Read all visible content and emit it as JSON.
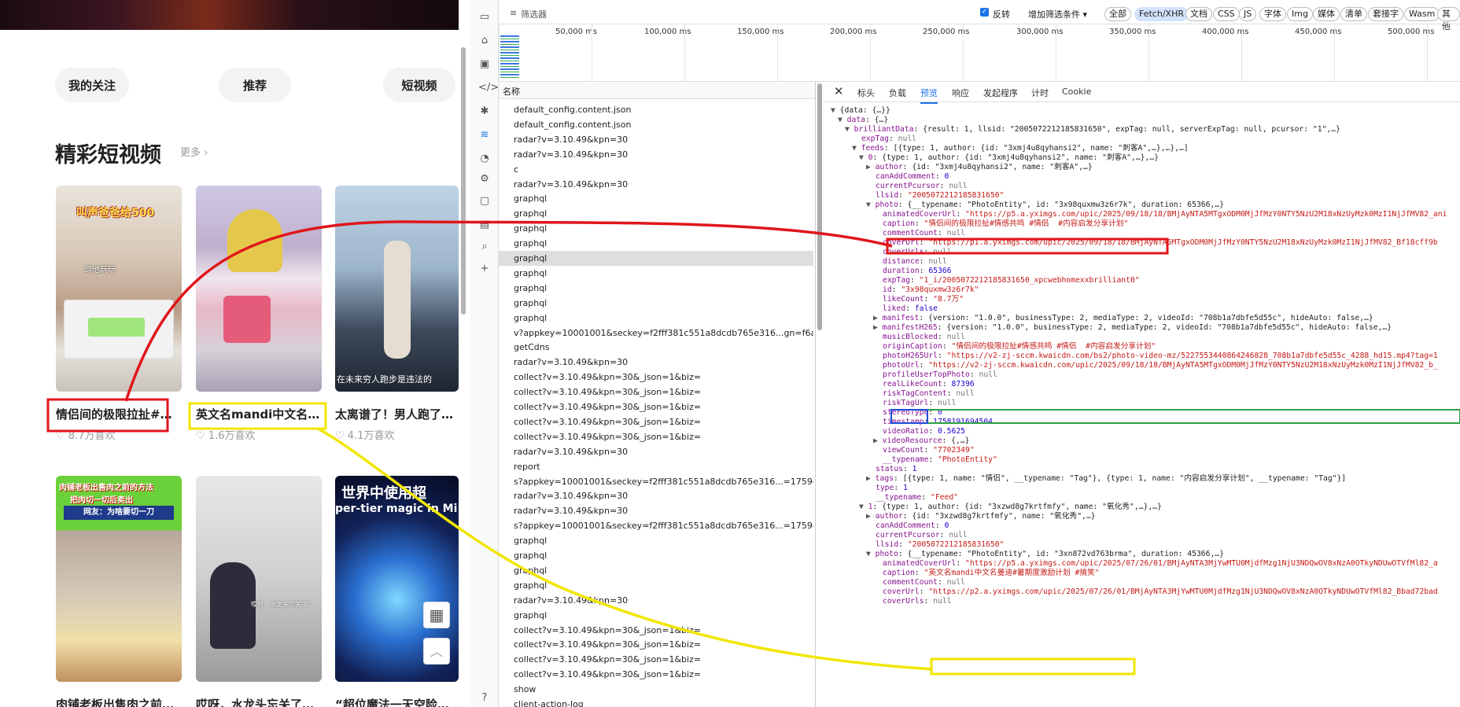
{
  "left": {
    "nav": [
      "我的关注",
      "推荐",
      "短视频"
    ],
    "section_title": "精彩短视频",
    "more_link": "更多",
    "cards_row1": [
      {
        "title": "情侣间的极限拉扯#情…",
        "likes": "8.7万喜欢",
        "overlay_top": "叫声爸爸给500",
        "overlay_mid": "逗他玩玩"
      },
      {
        "title": "英文名mandi中文名…",
        "likes": "1.6万喜欢",
        "overlay_top": "",
        "overlay_mid": ""
      },
      {
        "title": "太离谱了！男人跑了…",
        "likes": "4.1万喜欢",
        "overlay_top": "",
        "overlay_mid": "在未来穷人跑步是违法的"
      }
    ],
    "cards_row2": [
      {
        "title": "肉铺老板出售肉之前…",
        "overlay_top": "肉铺老板出售肉之前的方法",
        "overlay_mid": "把肉切一切后卖出",
        "overlay_sub": "网友：为啥要切一刀"
      },
      {
        "title": "哎呀，水龙头忘关了…",
        "overlay_mid": "哎呀，水龙头忘关了！"
      },
      {
        "title": "“超位魔法一天空险…",
        "overlay_top": "世界中使用超",
        "overlay_mid": "per-tier magic in  Mi"
      }
    ]
  },
  "devtools": {
    "filter_placeholder": "筛选器",
    "invert": "反转",
    "more_filters": "增加筛选条件",
    "type_buttons": [
      "全部",
      "Fetch/XHR",
      "文档",
      "CSS",
      "JS",
      "字体",
      "Img",
      "媒体",
      "清单",
      "套接字",
      "Wasm",
      "其他"
    ],
    "timeline_ticks": [
      "50,000 ms",
      "100,000 ms",
      "150,000 ms",
      "200,000 ms",
      "250,000 ms",
      "300,000 ms",
      "350,000 ms",
      "400,000 ms",
      "450,000 ms",
      "500,000 ms"
    ],
    "name_header": "名称",
    "requests": [
      "default_config.content.json",
      "default_config.content.json",
      "radar?v=3.10.49&kpn=30",
      "radar?v=3.10.49&kpn=30",
      "c",
      "radar?v=3.10.49&kpn=30",
      "graphql",
      "graphql",
      "graphql",
      "graphql",
      "graphql",
      "graphql",
      "graphql",
      "graphql",
      "graphql",
      "v?appkey=10001001&seckey=f2fff381c551a8dcdb765e316...gn=f6ad2...",
      "getCdns",
      "radar?v=3.10.49&kpn=30",
      "collect?v=3.10.49&kpn=30&_json=1&biz=",
      "collect?v=3.10.49&kpn=30&_json=1&biz=",
      "collect?v=3.10.49&kpn=30&_json=1&biz=",
      "collect?v=3.10.49&kpn=30&_json=1&biz=",
      "collect?v=3.10.49&kpn=30&_json=1&biz=",
      "radar?v=3.10.49&kpn=30",
      "report",
      "s?appkey=10001001&seckey=f2fff381c551a8dcdb765e316...=1759480...",
      "radar?v=3.10.49&kpn=30",
      "radar?v=3.10.49&kpn=30",
      "s?appkey=10001001&seckey=f2fff381c551a8dcdb765e316...=1759480...",
      "graphql",
      "graphql",
      "graphql",
      "graphql",
      "radar?v=3.10.49&kpn=30",
      "graphql",
      "collect?v=3.10.49&kpn=30&_json=1&biz=",
      "collect?v=3.10.49&kpn=30&_json=1&biz=",
      "collect?v=3.10.49&kpn=30&_json=1&biz=",
      "collect?v=3.10.49&kpn=30&_json=1&biz=",
      "show",
      "client-action-log"
    ],
    "detail_tabs": [
      "标头",
      "负载",
      "预览",
      "响应",
      "发起程序",
      "计时",
      "Cookie"
    ]
  }
}
